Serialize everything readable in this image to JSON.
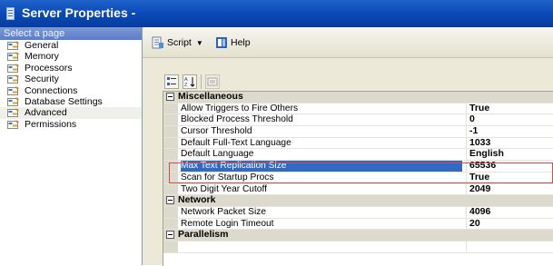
{
  "window": {
    "title": "Server Properties -"
  },
  "left_pane": {
    "header": "Select a page",
    "pages": [
      {
        "label": "General",
        "icon": "page-settings-icon",
        "selected": false
      },
      {
        "label": "Memory",
        "icon": "page-settings-icon",
        "selected": false
      },
      {
        "label": "Processors",
        "icon": "page-settings-icon",
        "selected": false
      },
      {
        "label": "Security",
        "icon": "page-settings-icon",
        "selected": false
      },
      {
        "label": "Connections",
        "icon": "page-settings-icon",
        "selected": false
      },
      {
        "label": "Database Settings",
        "icon": "page-settings-icon",
        "selected": false
      },
      {
        "label": "Advanced",
        "icon": "page-settings-icon",
        "selected": true
      },
      {
        "label": "Permissions",
        "icon": "page-settings-icon",
        "selected": false
      }
    ]
  },
  "toolbar": {
    "script_label": "Script",
    "help_label": "Help"
  },
  "property_grid": {
    "categories": [
      {
        "name": "Miscellaneous",
        "properties": [
          {
            "name": "Allow Triggers to Fire Others",
            "value": "True"
          },
          {
            "name": "Blocked Process Threshold",
            "value": "0"
          },
          {
            "name": "Cursor Threshold",
            "value": "-1"
          },
          {
            "name": "Default Full-Text Language",
            "value": "1033"
          },
          {
            "name": "Default Language",
            "value": "English"
          },
          {
            "name": "Max Text Replication Size",
            "value": "65536",
            "selected": true
          },
          {
            "name": "Scan for Startup Procs",
            "value": "True"
          },
          {
            "name": "Two Digit Year Cutoff",
            "value": "2049"
          }
        ]
      },
      {
        "name": "Network",
        "properties": [
          {
            "name": "Network Packet Size",
            "value": "4096"
          },
          {
            "name": "Remote Login Timeout",
            "value": "20"
          }
        ]
      },
      {
        "name": "Parallelism",
        "properties": [
          {
            "name": "",
            "value": ""
          }
        ]
      }
    ]
  },
  "colors": {
    "title_bar": "#0a4ab8",
    "selection": "#316ac5",
    "highlight_box": "#d84a4a"
  }
}
